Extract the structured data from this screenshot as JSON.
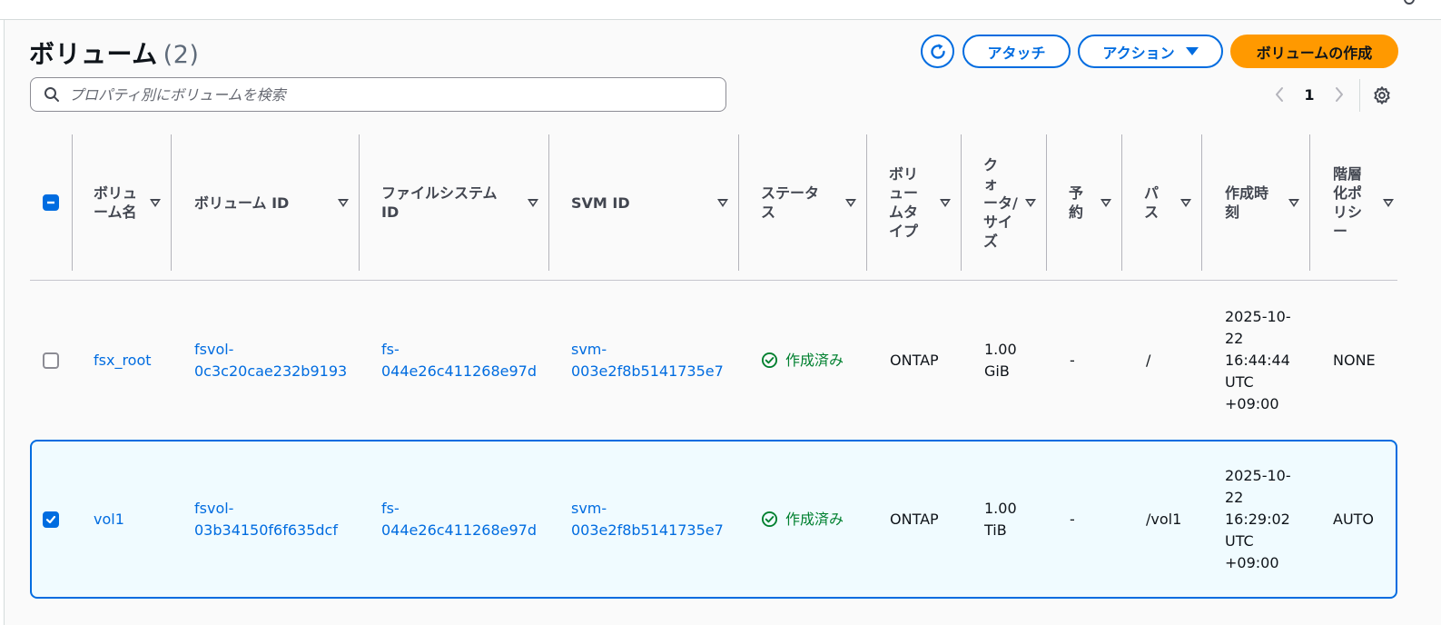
{
  "header": {
    "title": "ボリューム",
    "count": "(2)"
  },
  "toolbar": {
    "attach_label": "アタッチ",
    "actions_label": "アクション",
    "create_label": "ボリュームの作成"
  },
  "search": {
    "placeholder": "プロパティ別にボリュームを検索"
  },
  "pagination": {
    "current_page": "1"
  },
  "table": {
    "columns": [
      "ボリュ\nーム名",
      "ボリューム ID",
      "ファイルシステム\nID",
      "SVM ID",
      "ステータ\nス",
      "ボリ\nュー\nムタ\nイプ",
      "ク\nォ\nータ/\nサイ\nズ",
      "予\n約",
      "パ\nス",
      "作成時\n刻",
      "階層\n化ポ\nリシ\nー"
    ],
    "rows": [
      {
        "selected": false,
        "name": "fsx_root",
        "volume_id": "fsvol-\n0c3c20cae232b9193",
        "fs_id": "fs-\n044e26c411268e97d",
        "svm_id": "svm-\n003e2f8b5141735e7",
        "status": "作成済み",
        "type": "ONTAP",
        "size": "1.00\nGiB",
        "reservation": "-",
        "path": "/",
        "created": "2025-10-\n22\n16:44:44\nUTC\n+09:00",
        "tiering": "NONE"
      },
      {
        "selected": true,
        "name": "vol1",
        "volume_id": "fsvol-\n03b34150f6f635dcf",
        "fs_id": "fs-\n044e26c411268e97d",
        "svm_id": "svm-\n003e2f8b5141735e7",
        "status": "作成済み",
        "type": "ONTAP",
        "size": "1.00\nTiB",
        "reservation": "-",
        "path": "/vol1",
        "created": "2025-10-\n22\n16:29:02\nUTC\n+09:00",
        "tiering": "AUTO"
      }
    ]
  },
  "colors": {
    "primary": "#006ce0",
    "create_button": "#ff9900",
    "status_success": "#00802f",
    "selected_row_bg": "#f0fbff"
  },
  "icons": {
    "refresh": "refresh-icon",
    "search": "search-icon",
    "settings": "gear-icon",
    "status": "check-circle-icon"
  }
}
